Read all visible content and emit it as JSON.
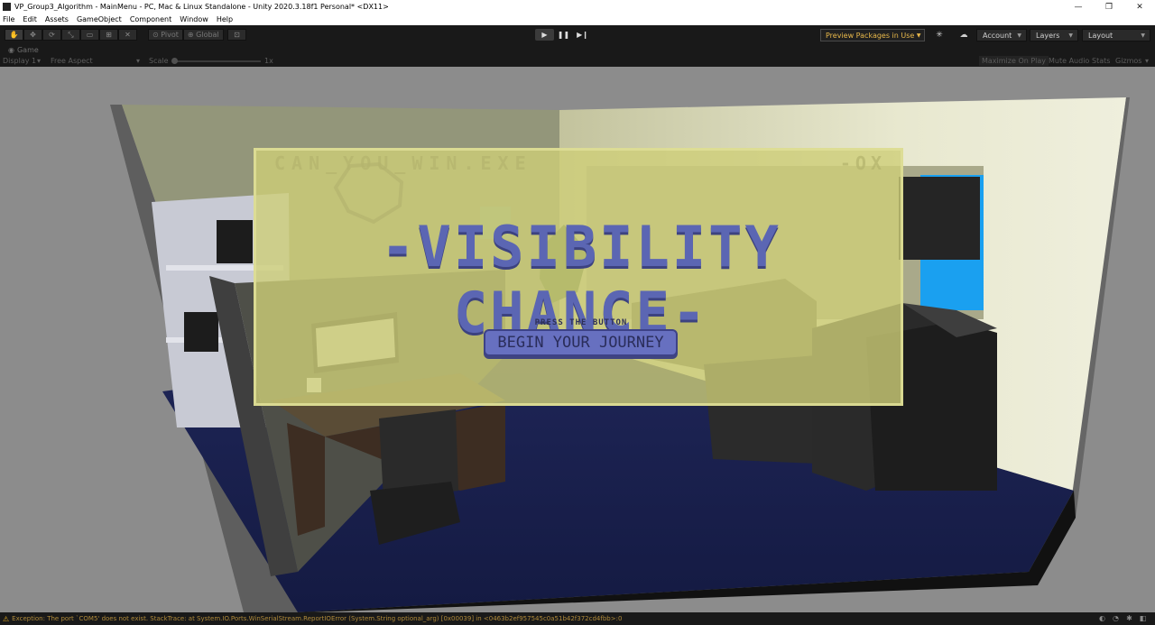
{
  "window": {
    "title": "VP_Group3_Algorithm - MainMenu - PC, Mac & Linux Standalone - Unity 2020.3.18f1 Personal* <DX11>",
    "controls": {
      "minimize": "—",
      "restore": "❐",
      "close": "✕"
    }
  },
  "menu": {
    "items": [
      "File",
      "Edit",
      "Assets",
      "GameObject",
      "Component",
      "Window",
      "Help"
    ]
  },
  "toolbar": {
    "pivot_label": "Pivot",
    "global_label": "Global",
    "preview_packages_label": "Preview Packages in Use",
    "account_label": "Account",
    "layers_label": "Layers",
    "layout_label": "Layout",
    "accent_color": "#e8b84a"
  },
  "game_tab": {
    "tab_label": "Game",
    "display_label": "Display 1",
    "aspect_label": "Free Aspect",
    "scale_label": "Scale",
    "scale_value": "1x",
    "maximize_label": "Maximize On Play",
    "mute_label": "Mute Audio",
    "stats_label": "Stats",
    "gizmos_label": "Gizmos"
  },
  "overlay": {
    "window_title": "CAN_YOU_WIN.EXE",
    "window_controls": "-OX",
    "game_title": "-VISIBILITY CHANCE-",
    "press_label": "PRESS THE BUTTON",
    "begin_button": "BEGIN YOUR JOURNEY",
    "title_color": "#5b66b3"
  },
  "status": {
    "message": "Exception: The port `COM5' does not exist. StackTrace:   at System.IO.Ports.WinSerialStream.ReportIOError (System.String optional_arg) [0x00039] in <0463b2ef957545c0a51b42f372cd4fbb>:0",
    "color": "#b08a3a"
  }
}
